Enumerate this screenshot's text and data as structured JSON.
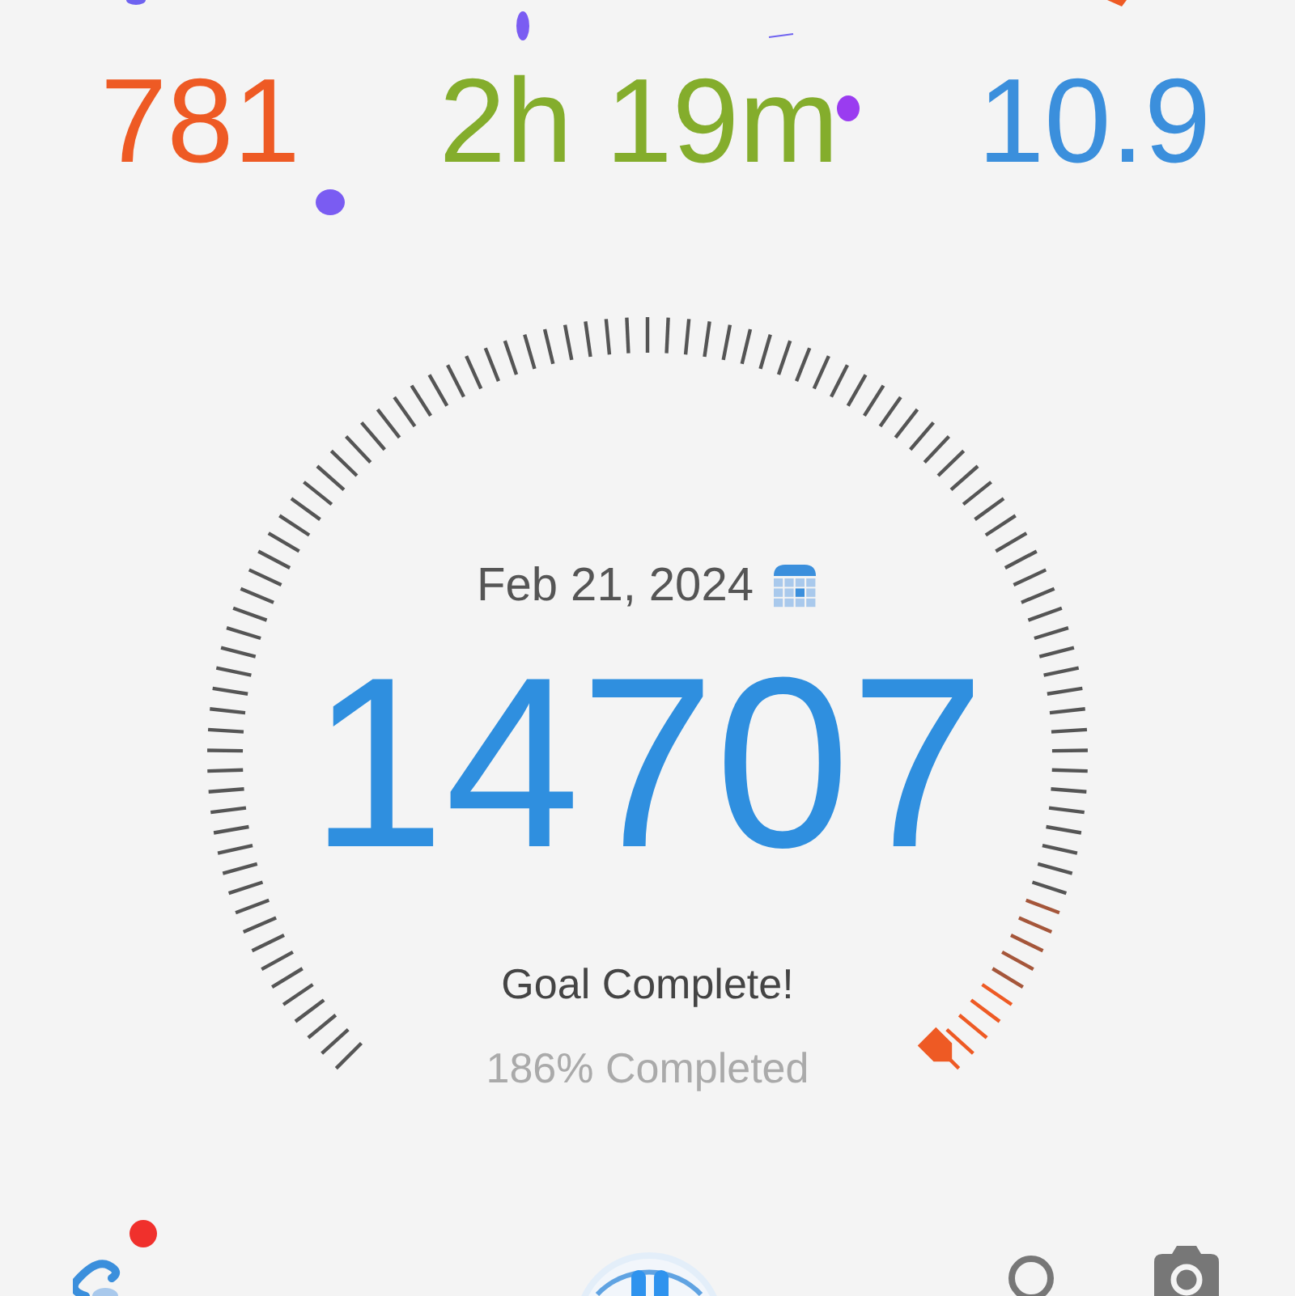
{
  "stats": [
    {
      "value": "781",
      "color": "#ee5a24"
    },
    {
      "value": "2h 19m",
      "color": "#84ad2c"
    },
    {
      "value": "10.9",
      "color": "#3b8fdc"
    }
  ],
  "gauge": {
    "date": "Feb 21, 2024",
    "steps": "14707",
    "status": "Goal Complete!",
    "progress": "186% Completed"
  },
  "tab_bar": {
    "activity_badge": true
  }
}
